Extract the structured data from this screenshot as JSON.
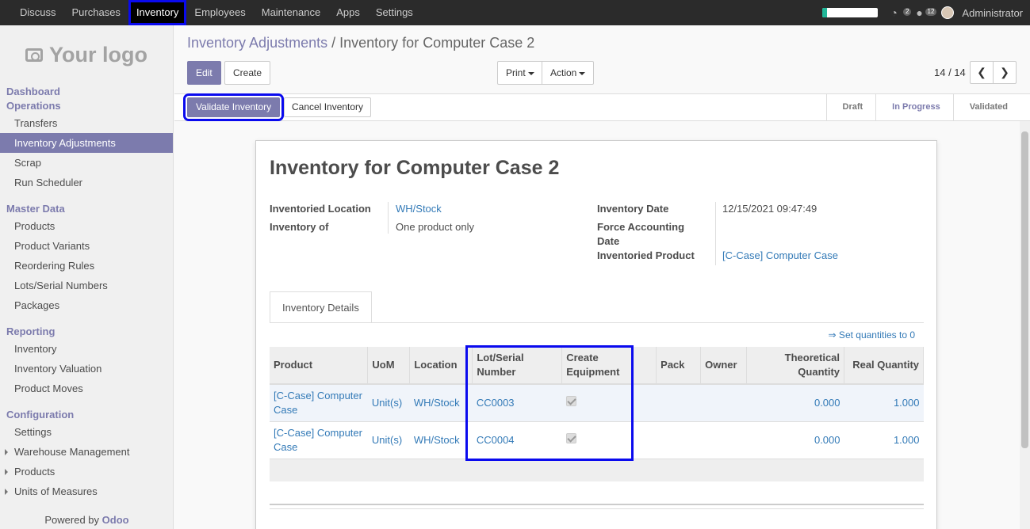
{
  "nav": {
    "menu": [
      "Discuss",
      "Purchases",
      "Inventory",
      "Employees",
      "Maintenance",
      "Apps",
      "Settings"
    ],
    "progress_fraction": 0.08,
    "chat_count": "2",
    "messages_count": "12",
    "user": "Administrator"
  },
  "sidebar": {
    "logo": "Your logo",
    "sections": {
      "dashboard": "Dashboard",
      "operations": "Operations",
      "master_data": "Master Data",
      "reporting": "Reporting",
      "configuration": "Configuration"
    },
    "operations": [
      "Transfers",
      "Inventory Adjustments",
      "Scrap",
      "Run Scheduler"
    ],
    "master_data": [
      "Products",
      "Product Variants",
      "Reordering Rules",
      "Lots/Serial Numbers",
      "Packages"
    ],
    "reporting": [
      "Inventory",
      "Inventory Valuation",
      "Product Moves"
    ],
    "configuration": [
      "Settings",
      "Warehouse Management",
      "Products",
      "Units of Measures"
    ],
    "powered_prefix": "Powered by",
    "powered_brand": "Odoo"
  },
  "control": {
    "breadcrumb_parent": "Inventory Adjustments",
    "breadcrumb_sep": "/",
    "breadcrumb_current": "Inventory for Computer Case 2",
    "edit": "Edit",
    "create": "Create",
    "print": "Print",
    "action": "Action",
    "pager": "14 / 14"
  },
  "status": {
    "validate": "Validate Inventory",
    "cancel": "Cancel Inventory",
    "stages": [
      "Draft",
      "In Progress",
      "Validated"
    ],
    "current_stage": "In Progress"
  },
  "form": {
    "title": "Inventory for Computer Case 2",
    "inventoried_location_label": "Inventoried Location",
    "inventoried_location": "WH/Stock",
    "inventory_of_label": "Inventory of",
    "inventory_of": "One product only",
    "inventory_date_label": "Inventory Date",
    "inventory_date": "12/15/2021 09:47:49",
    "force_accounting_date_label": "Force Accounting Date",
    "inventoried_product_label": "Inventoried Product",
    "inventoried_product": "[C-Case] Computer Case",
    "tab": "Inventory Details",
    "set_quantities": "⇒ Set quantities to 0"
  },
  "table": {
    "headers": {
      "product": "Product",
      "uom": "UoM",
      "location": "Location",
      "lot": "Lot/Serial Number",
      "create_equipment": "Create Equipment",
      "pack": "Pack",
      "owner": "Owner",
      "theoretical": "Theoretical Quantity",
      "real": "Real Quantity"
    },
    "rows": [
      {
        "product": "[C-Case] Computer Case",
        "uom": "Unit(s)",
        "location": "WH/Stock",
        "lot": "CC0003",
        "create_equipment": true,
        "theoretical": "0.000",
        "real": "1.000"
      },
      {
        "product": "[C-Case] Computer Case",
        "uom": "Unit(s)",
        "location": "WH/Stock",
        "lot": "CC0004",
        "create_equipment": true,
        "theoretical": "0.000",
        "real": "1.000"
      }
    ]
  }
}
